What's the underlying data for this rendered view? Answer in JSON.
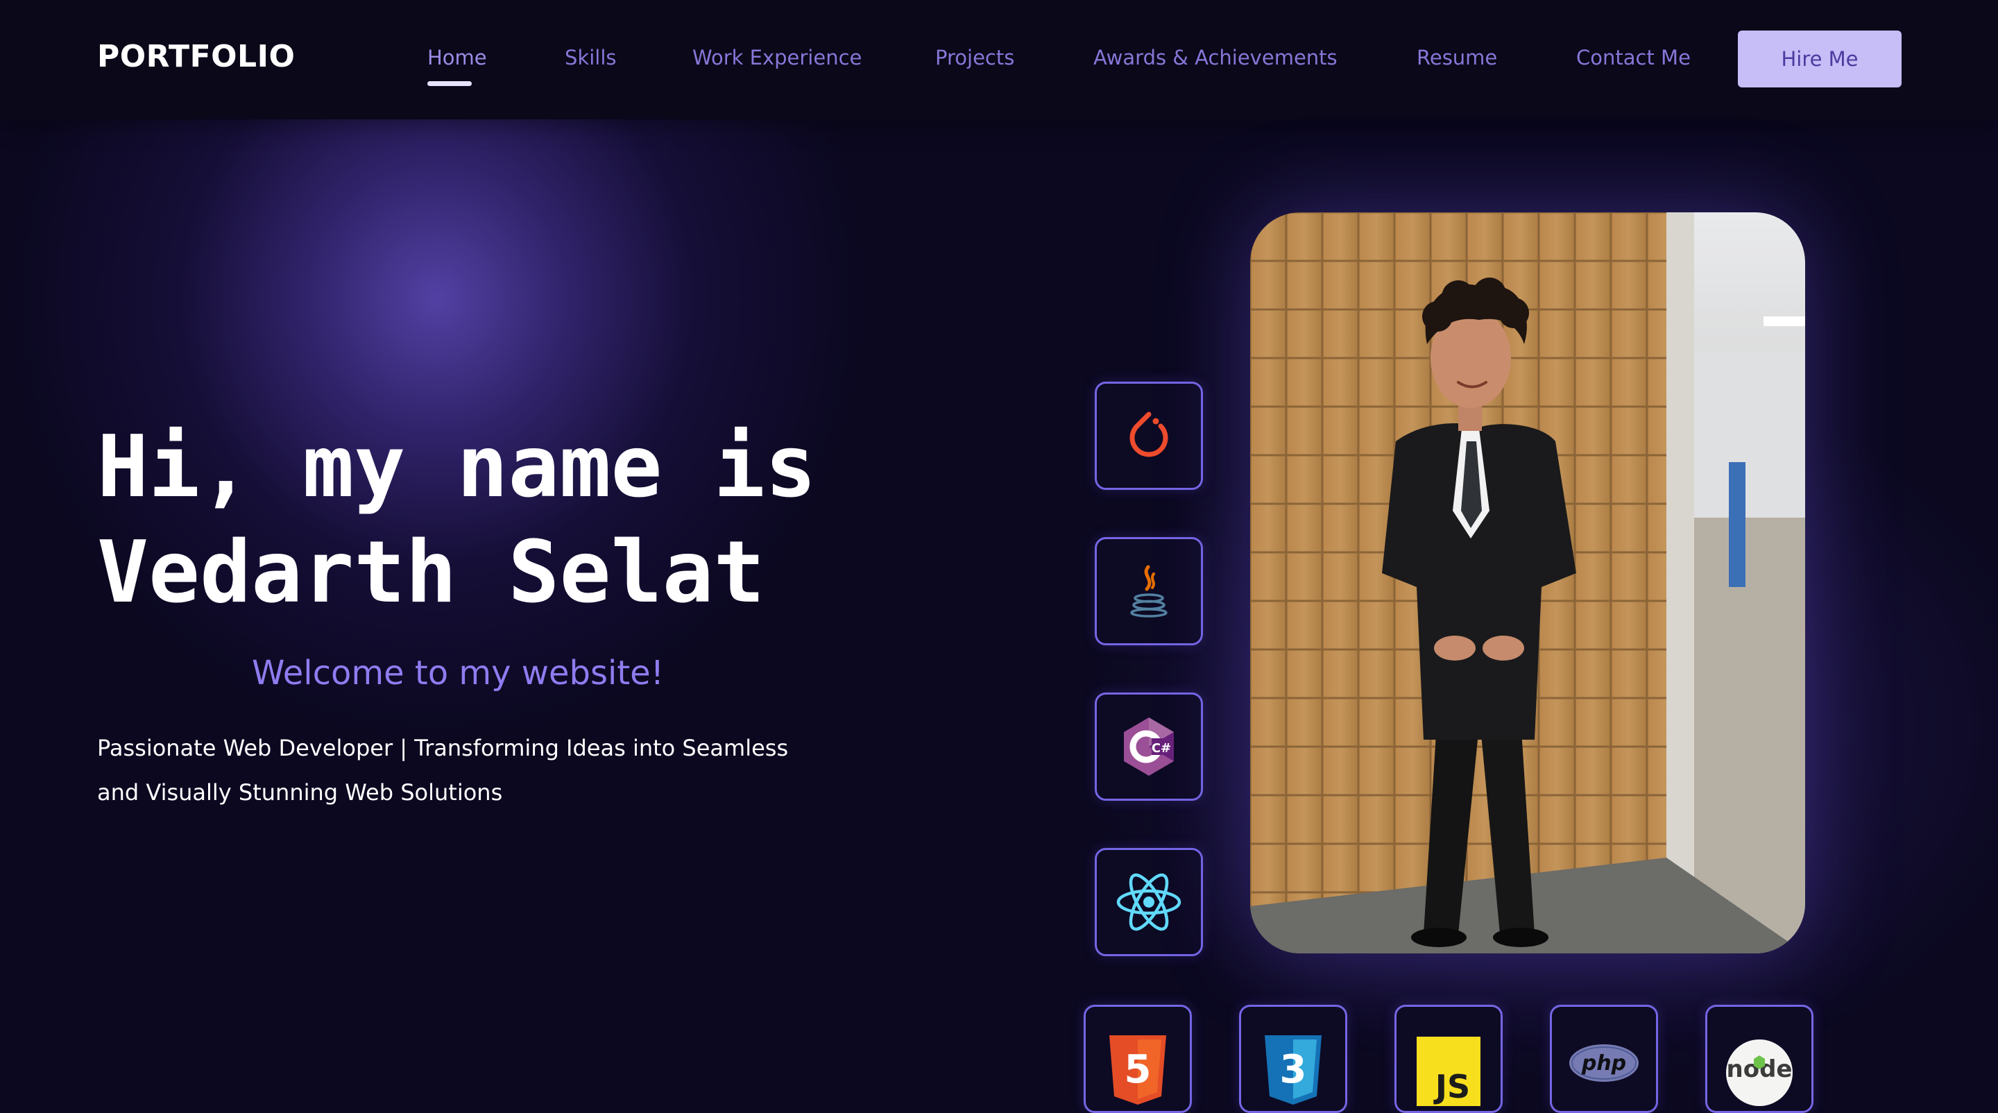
{
  "nav": {
    "logo": "PORTFOLIO",
    "items": [
      {
        "label": "Home",
        "active": true
      },
      {
        "label": "Skills"
      },
      {
        "label": "Work Experience"
      },
      {
        "label": "Projects"
      },
      {
        "label": "Awards & Achievements"
      },
      {
        "label": "Resume"
      },
      {
        "label": "Contact Me"
      }
    ],
    "cta_label": "Hire Me"
  },
  "hero": {
    "title_line1": "Hi, my name is",
    "title_line2": "Vedarth Selat",
    "welcome": "Welcome to my website!",
    "tagline_line1": "Passionate Web Developer | Transforming Ideas into Seamless",
    "tagline_line2": "and Visually Stunning Web Solutions"
  },
  "photo": {
    "alt_subject": "profile-photo"
  },
  "skills_column": [
    {
      "icon": "pytorch-icon"
    },
    {
      "icon": "java-icon"
    },
    {
      "icon": "csharp-icon",
      "glyph": "C#"
    },
    {
      "icon": "react-icon"
    }
  ],
  "skills_row": [
    {
      "icon": "html5-icon",
      "glyph": "5"
    },
    {
      "icon": "css3-icon",
      "glyph": "3"
    },
    {
      "icon": "javascript-icon",
      "glyph": "JS"
    },
    {
      "icon": "php-icon",
      "glyph": "php"
    },
    {
      "icon": "nodejs-icon",
      "glyph": "node"
    }
  ],
  "colors": {
    "background": "#0b0820",
    "accent": "#8f7cf0",
    "nav_link": "#8677d8",
    "button_bg": "#c7bdf7",
    "button_text": "#4a3ca0",
    "tile_border": "#7466e4"
  }
}
